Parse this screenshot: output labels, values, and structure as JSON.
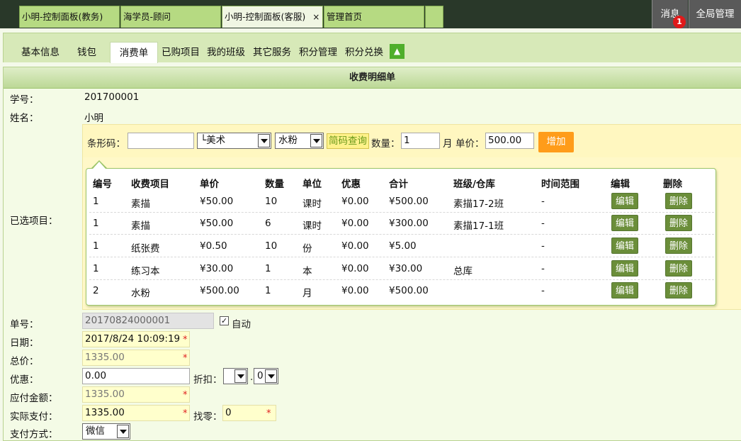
{
  "top_tabs": [
    {
      "label": "小明-控制面板(教务)",
      "active": false
    },
    {
      "label": "海学员-顾问",
      "active": false
    },
    {
      "label": "小明-控制面板(客服)",
      "active": true,
      "close": "×"
    },
    {
      "label": "管理首页",
      "active": false
    }
  ],
  "top_buttons": {
    "messages": "消息",
    "message_count": "1",
    "global": "全局管理"
  },
  "sub_tabs": [
    "基本信息",
    "钱包",
    "消费单",
    "已购项目",
    "我的班级",
    "其它服务",
    "积分管理",
    "积分兑换"
  ],
  "sub_tabs_active": "消费单",
  "sub_tabs_toggle": "▲",
  "panel_title": "收费明细单",
  "student": {
    "id_label": "学号：",
    "id_value": "201700001",
    "name_label": "姓名：",
    "name_value": "小明"
  },
  "picker": {
    "selected_label": "已选项目：",
    "barcode_label": "条形码：",
    "barcode_value": "",
    "category_value": "└美术",
    "product_value": "水粉",
    "search_button": "简码查询",
    "qty_label": "数量：",
    "qty_value": "1",
    "unit_label": "月",
    "price_label": "单价：",
    "price_value": "500.00",
    "add_button": "增加"
  },
  "items": {
    "headers": [
      "编号",
      "收费项目",
      "单价",
      "数量",
      "单位",
      "优惠",
      "合计",
      "班级/仓库",
      "时间范围",
      "编辑",
      "删除"
    ],
    "edit_label": "编辑",
    "delete_label": "删除",
    "rows": [
      {
        "no": "1",
        "name": "素描",
        "price": "¥50.00",
        "qty": "10",
        "unit": "课时",
        "discount": "¥0.00",
        "total": "¥500.00",
        "class": "素描17-2班",
        "range": "-"
      },
      {
        "no": "1",
        "name": "素描",
        "price": "¥50.00",
        "qty": "6",
        "unit": "课时",
        "discount": "¥0.00",
        "total": "¥300.00",
        "class": "素描17-1班",
        "range": "-"
      },
      {
        "no": "1",
        "name": "纸张费",
        "price": "¥0.50",
        "qty": "10",
        "unit": "份",
        "discount": "¥0.00",
        "total": "¥5.00",
        "class": "",
        "range": "-"
      },
      {
        "no": "1",
        "name": "练习本",
        "price": "¥30.00",
        "qty": "1",
        "unit": "本",
        "discount": "¥0.00",
        "total": "¥30.00",
        "class": "总库",
        "range": "-"
      },
      {
        "no": "2",
        "name": "水粉",
        "price": "¥500.00",
        "qty": "1",
        "unit": "月",
        "discount": "¥0.00",
        "total": "¥500.00",
        "class": "",
        "range": "-"
      }
    ]
  },
  "form": {
    "order_label": "单号：",
    "order_value": "20170824000001",
    "auto_label": "自动",
    "auto_check": "✓",
    "date_label": "日期：",
    "date_value": "2017/8/24 10:09:19",
    "total_label": "总价：",
    "total_value": "1335.00",
    "discount_label": "优惠：",
    "discount_value": "0.00",
    "rebate_label": "折扣：",
    "rebate_value1": "",
    "rebate_sep": ".",
    "rebate_value2": "0",
    "payable_label": "应付金额：",
    "payable_value": "1335.00",
    "paid_label": "实际支付：",
    "paid_value": "1335.00",
    "change_label": "找零：",
    "change_value": "0",
    "method_label": "支付方式：",
    "method_value": "微信",
    "required_mark": "*"
  }
}
